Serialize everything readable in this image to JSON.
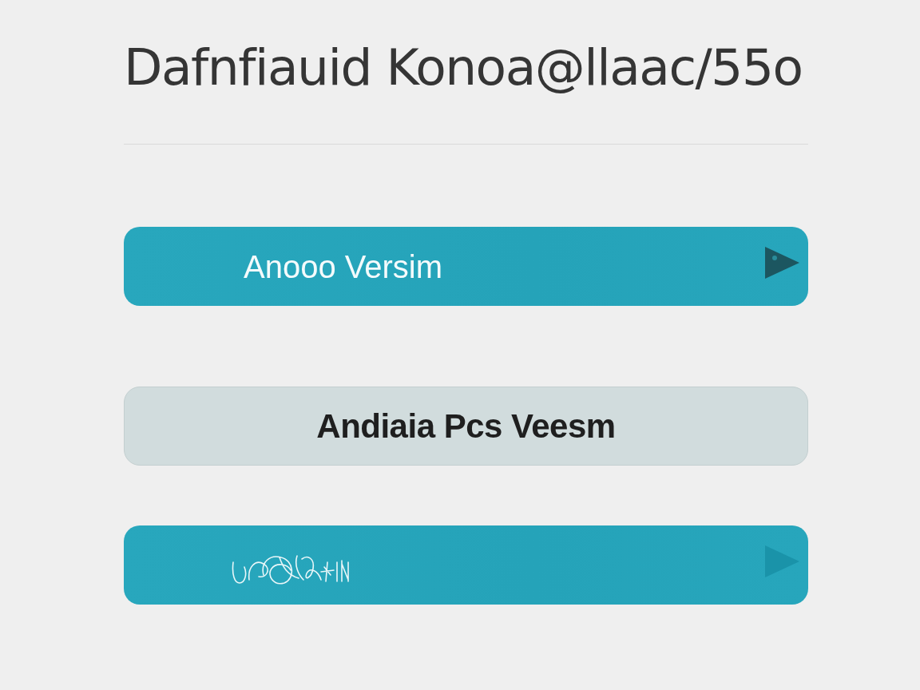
{
  "title": "Dafnfiauid Konoa@llaac/55o",
  "options": [
    {
      "kind": "primary",
      "label": "Anooo Versim",
      "arrow": true,
      "arrow_faint": false
    },
    {
      "kind": "secondary",
      "label": "Andiaia Pcs Veesm",
      "arrow": false
    },
    {
      "kind": "scribbled",
      "arrow": true,
      "arrow_faint": true
    }
  ]
}
